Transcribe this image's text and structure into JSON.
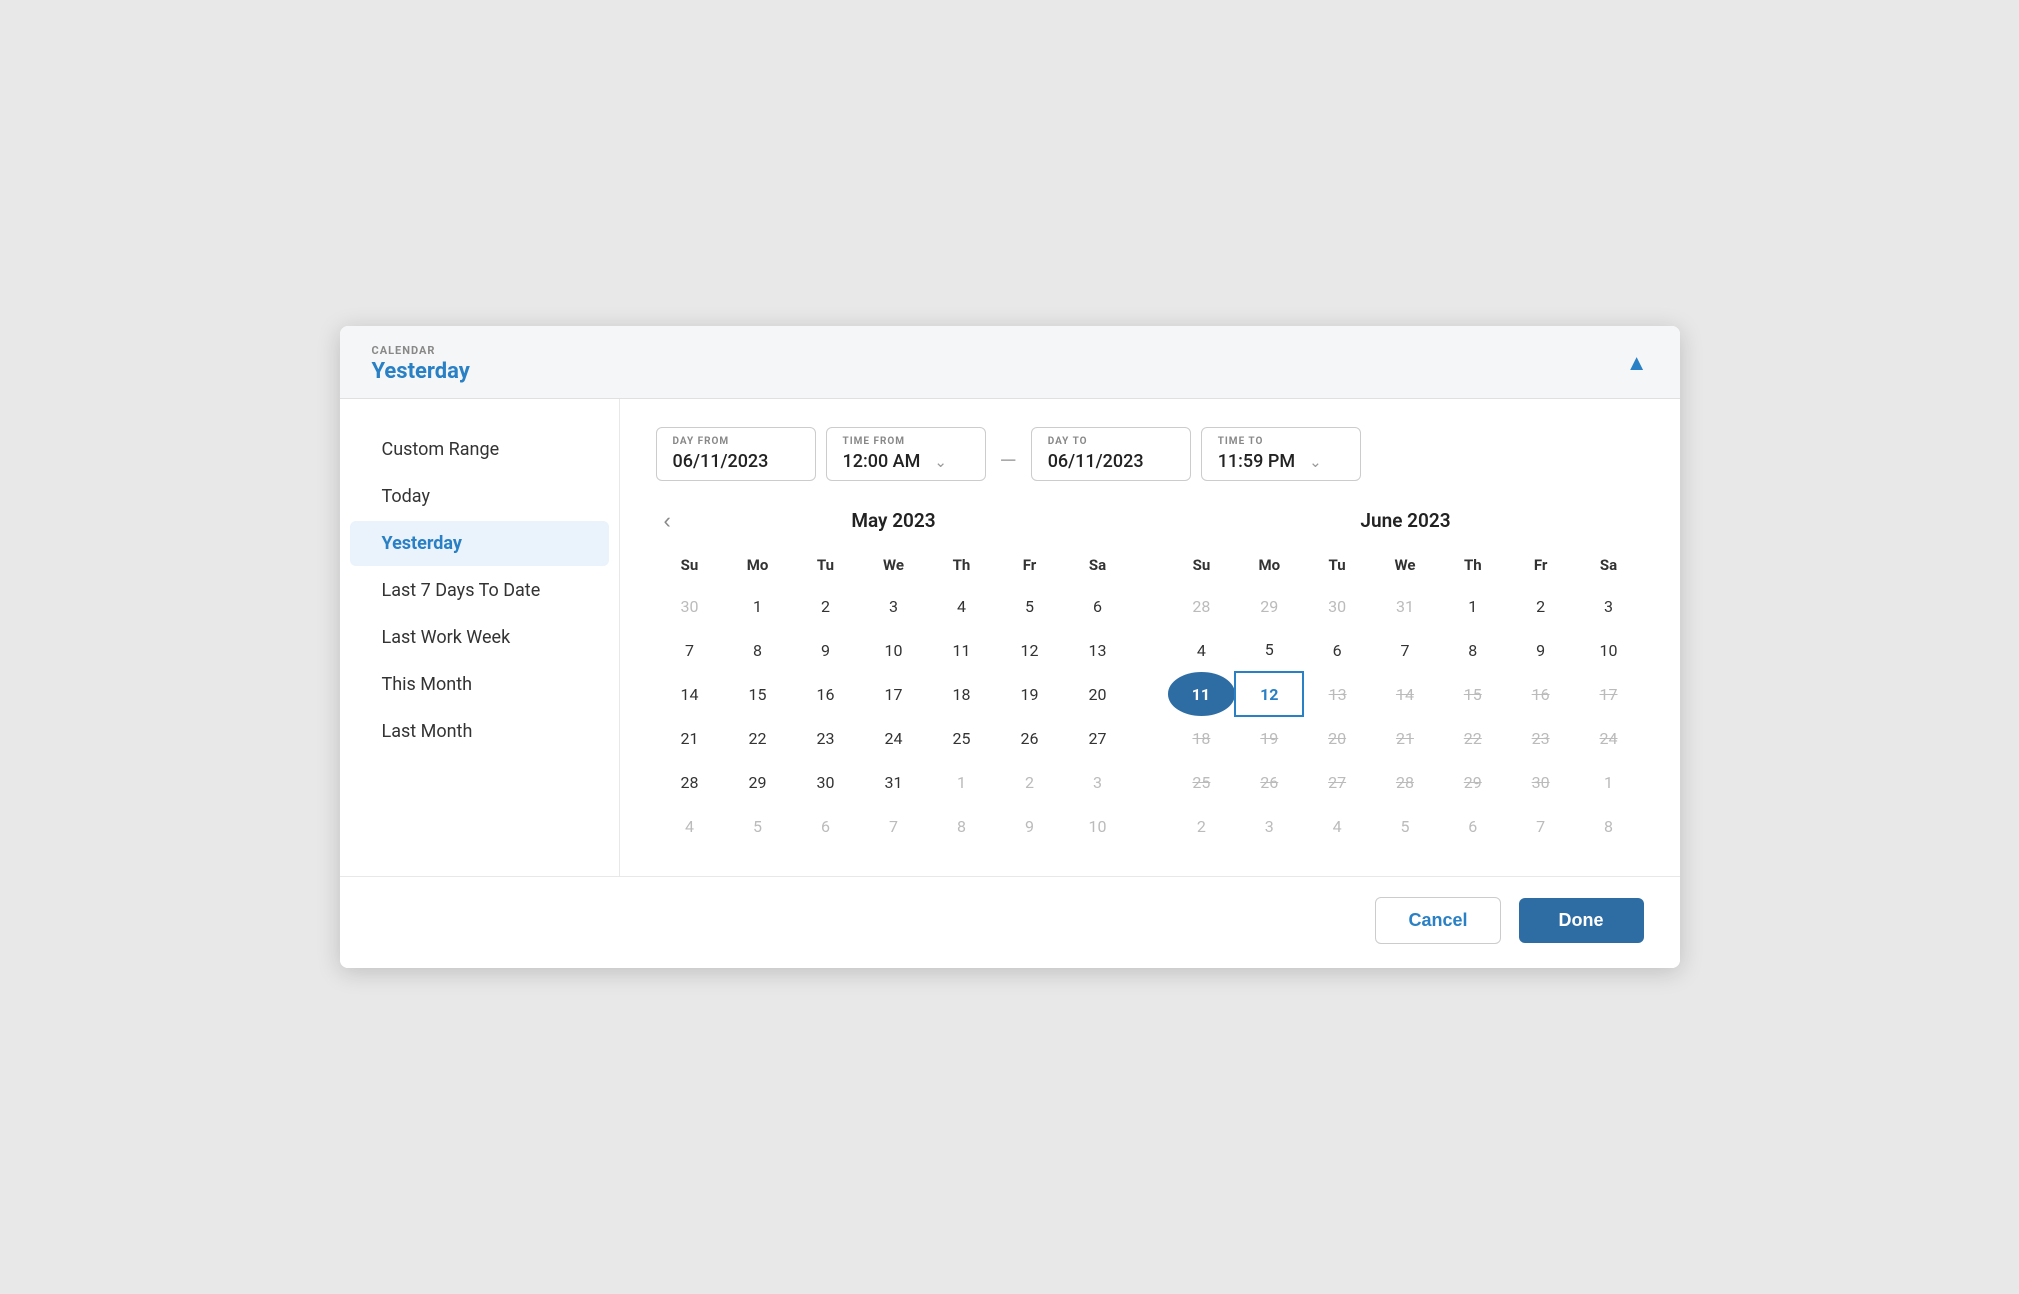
{
  "header": {
    "label": "CALENDAR",
    "value": "Yesterday",
    "chevron": "▲"
  },
  "sidebar": {
    "items": [
      {
        "id": "custom-range",
        "label": "Custom Range",
        "active": false
      },
      {
        "id": "today",
        "label": "Today",
        "active": false
      },
      {
        "id": "yesterday",
        "label": "Yesterday",
        "active": true
      },
      {
        "id": "last-7-days",
        "label": "Last 7 Days To Date",
        "active": false
      },
      {
        "id": "last-work-week",
        "label": "Last Work Week",
        "active": false
      },
      {
        "id": "this-month",
        "label": "This Month",
        "active": false
      },
      {
        "id": "last-month",
        "label": "Last Month",
        "active": false
      }
    ]
  },
  "dateRange": {
    "dayFrom": {
      "label": "DAY FROM",
      "value": "06/11/2023"
    },
    "timeFrom": {
      "label": "TIME FROM",
      "value": "12:00 AM"
    },
    "dash": "—",
    "dayTo": {
      "label": "DAY TO",
      "value": "06/11/2023"
    },
    "timeTo": {
      "label": "TIME TO",
      "value": "11:59 PM"
    }
  },
  "calendars": [
    {
      "id": "may",
      "title": "May 2023",
      "showPrev": true,
      "showNext": false,
      "weekdays": [
        "Su",
        "Mo",
        "Tu",
        "We",
        "Th",
        "Fr",
        "Sa"
      ],
      "weeks": [
        [
          {
            "day": "30",
            "type": "other-month"
          },
          {
            "day": "1",
            "type": "normal"
          },
          {
            "day": "2",
            "type": "normal"
          },
          {
            "day": "3",
            "type": "normal"
          },
          {
            "day": "4",
            "type": "normal"
          },
          {
            "day": "5",
            "type": "normal"
          },
          {
            "day": "6",
            "type": "normal"
          }
        ],
        [
          {
            "day": "7",
            "type": "normal"
          },
          {
            "day": "8",
            "type": "normal"
          },
          {
            "day": "9",
            "type": "normal"
          },
          {
            "day": "10",
            "type": "normal"
          },
          {
            "day": "11",
            "type": "normal"
          },
          {
            "day": "12",
            "type": "normal"
          },
          {
            "day": "13",
            "type": "normal"
          }
        ],
        [
          {
            "day": "14",
            "type": "normal"
          },
          {
            "day": "15",
            "type": "normal"
          },
          {
            "day": "16",
            "type": "normal"
          },
          {
            "day": "17",
            "type": "normal"
          },
          {
            "day": "18",
            "type": "normal"
          },
          {
            "day": "19",
            "type": "normal"
          },
          {
            "day": "20",
            "type": "normal"
          }
        ],
        [
          {
            "day": "21",
            "type": "normal"
          },
          {
            "day": "22",
            "type": "normal"
          },
          {
            "day": "23",
            "type": "normal"
          },
          {
            "day": "24",
            "type": "normal"
          },
          {
            "day": "25",
            "type": "normal"
          },
          {
            "day": "26",
            "type": "normal"
          },
          {
            "day": "27",
            "type": "normal"
          }
        ],
        [
          {
            "day": "28",
            "type": "normal"
          },
          {
            "day": "29",
            "type": "normal"
          },
          {
            "day": "30",
            "type": "normal"
          },
          {
            "day": "31",
            "type": "normal"
          },
          {
            "day": "1",
            "type": "other-month"
          },
          {
            "day": "2",
            "type": "other-month"
          },
          {
            "day": "3",
            "type": "other-month"
          }
        ],
        [
          {
            "day": "4",
            "type": "other-month"
          },
          {
            "day": "5",
            "type": "other-month"
          },
          {
            "day": "6",
            "type": "other-month"
          },
          {
            "day": "7",
            "type": "other-month"
          },
          {
            "day": "8",
            "type": "other-month"
          },
          {
            "day": "9",
            "type": "other-month"
          },
          {
            "day": "10",
            "type": "other-month"
          }
        ]
      ]
    },
    {
      "id": "june",
      "title": "June 2023",
      "showPrev": false,
      "showNext": true,
      "weekdays": [
        "Su",
        "Mo",
        "Tu",
        "We",
        "Th",
        "Fr",
        "Sa"
      ],
      "weeks": [
        [
          {
            "day": "28",
            "type": "other-month"
          },
          {
            "day": "29",
            "type": "other-month"
          },
          {
            "day": "30",
            "type": "other-month"
          },
          {
            "day": "31",
            "type": "other-month"
          },
          {
            "day": "1",
            "type": "normal"
          },
          {
            "day": "2",
            "type": "normal"
          },
          {
            "day": "3",
            "type": "normal"
          }
        ],
        [
          {
            "day": "4",
            "type": "normal"
          },
          {
            "day": "5",
            "type": "normal"
          },
          {
            "day": "6",
            "type": "normal"
          },
          {
            "day": "7",
            "type": "normal"
          },
          {
            "day": "8",
            "type": "normal"
          },
          {
            "day": "9",
            "type": "normal"
          },
          {
            "day": "10",
            "type": "normal"
          }
        ],
        [
          {
            "day": "11",
            "type": "selected-start"
          },
          {
            "day": "12",
            "type": "selected-end"
          },
          {
            "day": "13",
            "type": "strikethrough"
          },
          {
            "day": "14",
            "type": "strikethrough"
          },
          {
            "day": "15",
            "type": "strikethrough"
          },
          {
            "day": "16",
            "type": "strikethrough"
          },
          {
            "day": "17",
            "type": "strikethrough"
          }
        ],
        [
          {
            "day": "18",
            "type": "strikethrough"
          },
          {
            "day": "19",
            "type": "strikethrough"
          },
          {
            "day": "20",
            "type": "strikethrough"
          },
          {
            "day": "21",
            "type": "strikethrough"
          },
          {
            "day": "22",
            "type": "strikethrough"
          },
          {
            "day": "23",
            "type": "strikethrough"
          },
          {
            "day": "24",
            "type": "strikethrough"
          }
        ],
        [
          {
            "day": "25",
            "type": "strikethrough"
          },
          {
            "day": "26",
            "type": "strikethrough"
          },
          {
            "day": "27",
            "type": "strikethrough"
          },
          {
            "day": "28",
            "type": "strikethrough"
          },
          {
            "day": "29",
            "type": "strikethrough"
          },
          {
            "day": "30",
            "type": "strikethrough"
          },
          {
            "day": "1",
            "type": "other-month"
          }
        ],
        [
          {
            "day": "2",
            "type": "other-month"
          },
          {
            "day": "3",
            "type": "other-month"
          },
          {
            "day": "4",
            "type": "other-month"
          },
          {
            "day": "5",
            "type": "other-month"
          },
          {
            "day": "6",
            "type": "other-month"
          },
          {
            "day": "7",
            "type": "other-month"
          },
          {
            "day": "8",
            "type": "other-month"
          }
        ]
      ]
    }
  ],
  "footer": {
    "cancel_label": "Cancel",
    "done_label": "Done"
  },
  "colors": {
    "accent": "#2980c4",
    "selected_start_bg": "#2e6da4",
    "selected_end_border": "#2980c4"
  }
}
